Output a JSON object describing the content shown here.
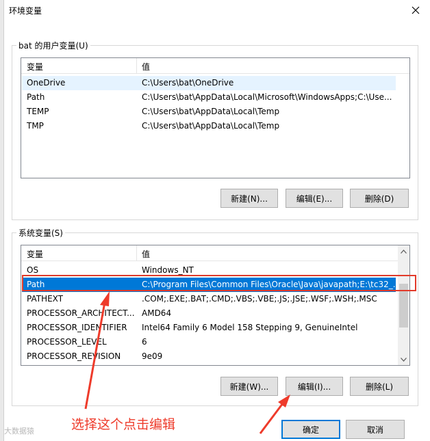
{
  "window": {
    "title": "环境变量"
  },
  "user_group": {
    "label": "bat 的用户变量(U)",
    "columns": [
      "变量",
      "值"
    ],
    "rows": [
      {
        "name": "OneDrive",
        "value": "C:\\Users\\bat\\OneDrive"
      },
      {
        "name": "Path",
        "value": "C:\\Users\\bat\\AppData\\Local\\Microsoft\\WindowsApps;C:\\Use..."
      },
      {
        "name": "TEMP",
        "value": "C:\\Users\\bat\\AppData\\Local\\Temp"
      },
      {
        "name": "TMP",
        "value": "C:\\Users\\bat\\AppData\\Local\\Temp"
      }
    ],
    "buttons": {
      "new": "新建(N)...",
      "edit": "编辑(E)...",
      "delete": "删除(D)"
    }
  },
  "system_group": {
    "label": "系统变量(S)",
    "columns": [
      "变量",
      "值"
    ],
    "rows": [
      {
        "name": "OS",
        "value": "Windows_NT"
      },
      {
        "name": "Path",
        "value": "C:\\Program Files\\Common Files\\Oracle\\Java\\javapath;E:\\tc32_..."
      },
      {
        "name": "PATHEXT",
        "value": ".COM;.EXE;.BAT;.CMD;.VBS;.VBE;.JS;.JSE;.WSF;.WSH;.MSC"
      },
      {
        "name": "PROCESSOR_ARCHITECT...",
        "value": "AMD64"
      },
      {
        "name": "PROCESSOR_IDENTIFIER",
        "value": "Intel64 Family 6 Model 158 Stepping 9, GenuineIntel"
      },
      {
        "name": "PROCESSOR_LEVEL",
        "value": "6"
      },
      {
        "name": "PROCESSOR_REVISION",
        "value": "9e09"
      }
    ],
    "buttons": {
      "new": "新建(W)...",
      "edit": "编辑(I)...",
      "delete": "删除(L)"
    }
  },
  "dialog_buttons": {
    "ok": "确定",
    "cancel": "取消"
  },
  "annotation": {
    "text": "选择这个点击编辑",
    "color": "#ee3b2b"
  },
  "watermark": "大数据猿",
  "colors": {
    "selection": "#0078d7",
    "hover": "#e5f3ff",
    "annotation_red": "#e23a2a"
  }
}
